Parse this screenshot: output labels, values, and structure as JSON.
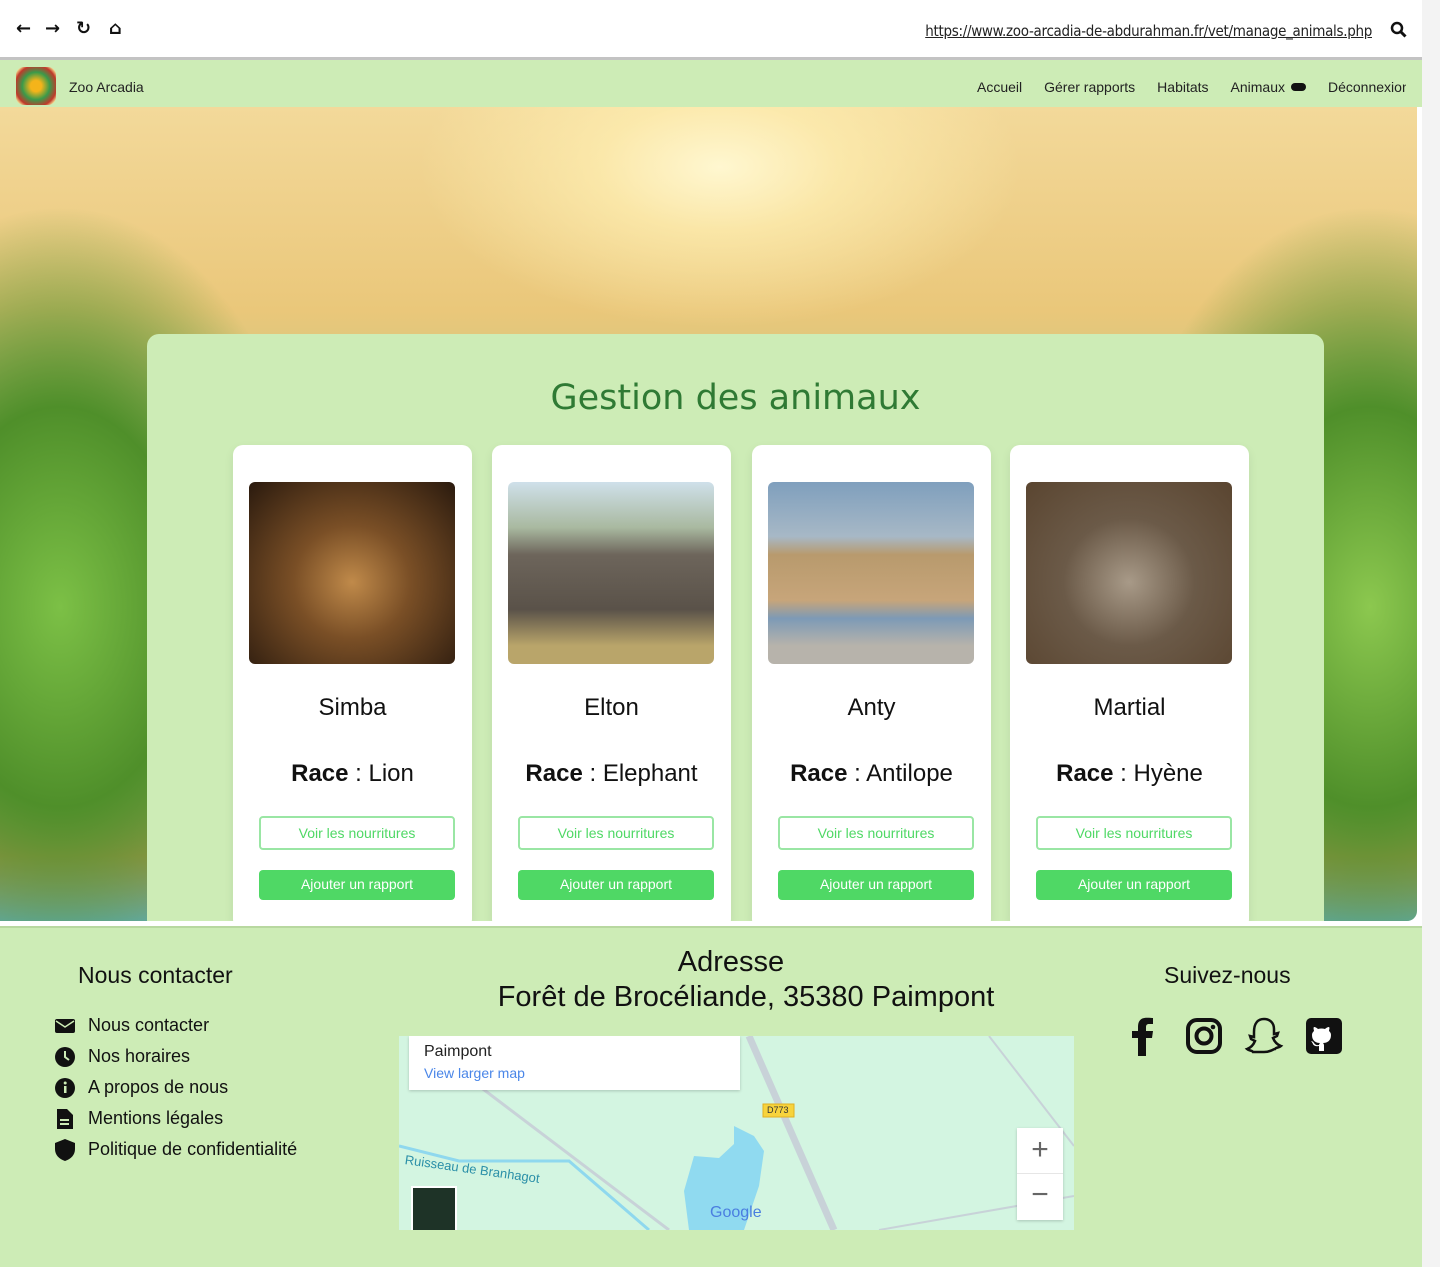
{
  "browser": {
    "url": "https://www.zoo-arcadia-de-abdurahman.fr/vet/manage_animals.php",
    "icons": [
      "arrow-left-icon",
      "arrow-right-icon",
      "reload-icon",
      "home-icon",
      "search-icon"
    ]
  },
  "nav": {
    "brand": "Zoo Arcadia",
    "links": [
      "Accueil",
      "Gérer rapports",
      "Habitats",
      "Animaux",
      "Déconnexion"
    ]
  },
  "main": {
    "title": "Gestion des animaux",
    "race_label": "Race",
    "animals": [
      {
        "name": "Simba",
        "race": "Lion"
      },
      {
        "name": "Elton",
        "race": "Elephant"
      },
      {
        "name": "Anty",
        "race": "Antilope"
      },
      {
        "name": "Martial",
        "race": "Hyène"
      }
    ],
    "view_food_label": "Voir les nourritures",
    "add_report_label": "Ajouter un rapport",
    "accent": "#4fd865"
  },
  "footer": {
    "contact_title": "Nous contacter",
    "contact_links": [
      "Nous contacter",
      "Nos horaires",
      "A propos de nous",
      "Mentions légales",
      "Politique de confidentialité"
    ],
    "address_title": "Adresse",
    "address": "Forêt de Brocéliande, 35380 Paimpont",
    "map": {
      "place": "Paimpont",
      "larger_link": "View larger map",
      "road": "D773",
      "stream": "Ruisseau de Branhagot",
      "brand": "Google"
    },
    "follow_title": "Suivez-nous",
    "social": [
      "facebook-icon",
      "instagram-icon",
      "snapchat-icon",
      "github-icon"
    ]
  }
}
